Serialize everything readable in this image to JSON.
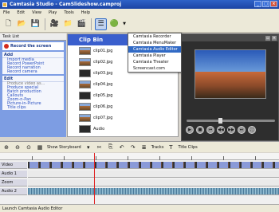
{
  "window": {
    "title": "Camtasia Studio - CamSlideshow.camproj",
    "controls": [
      "_",
      "□",
      "×"
    ]
  },
  "menu": [
    "File",
    "Edit",
    "View",
    "Play",
    "Tools",
    "Help"
  ],
  "task_panel": {
    "header": "Task List",
    "record_label": "Record the screen",
    "groups": [
      {
        "title": "Add",
        "items": [
          "Import media",
          "Record PowerPoint",
          "Record narration",
          "Record camera"
        ]
      },
      {
        "title": "Edit",
        "items": [
          "Produce video as...",
          "Produce special",
          "Batch production",
          "Callouts",
          "Zoom-n-Pan",
          "Picture-in-Picture",
          "Title clips"
        ]
      }
    ]
  },
  "clip_bin": {
    "title": "Clip Bin",
    "clips": [
      {
        "label": "clip01.jpg",
        "thumb": "land"
      },
      {
        "label": "clip02.jpg",
        "thumb": "land"
      },
      {
        "label": "clip03.jpg",
        "thumb": "dark"
      },
      {
        "label": "clip04.jpg",
        "thumb": "land"
      },
      {
        "label": "clip05.jpg",
        "thumb": "dark"
      },
      {
        "label": "clip06.jpg",
        "thumb": "land"
      },
      {
        "label": "clip07.jpg",
        "thumb": "land"
      },
      {
        "label": "Audio",
        "thumb": "dark"
      }
    ]
  },
  "tools_dropdown": {
    "items": [
      {
        "label": "Camtasia Recorder",
        "selected": false
      },
      {
        "label": "Camtasia MenuMaker",
        "selected": false
      },
      {
        "label": "Camtasia Audio Editor",
        "selected": true
      },
      {
        "label": "Camtasia Player",
        "selected": false
      },
      {
        "label": "Camtasia Theater",
        "selected": false
      },
      {
        "label": "Screencast.com",
        "selected": false
      }
    ]
  },
  "timeline_toolbar": {
    "show_storyboard": "Show Storyboard",
    "tracks": "Tracks",
    "title_clips": "Title Clips"
  },
  "tracks": [
    {
      "label": "Video",
      "kind": "video"
    },
    {
      "label": "Audio 1",
      "kind": "audio"
    },
    {
      "label": "Zoom",
      "kind": "audio"
    },
    {
      "label": "Audio 2",
      "kind": "audio2"
    }
  ],
  "statusbar": "Launch Camtasia Audio Editor",
  "colors": {
    "titlebar": "#2f62c8",
    "task_panel": "#7d9de3",
    "clip_bin_header": "#3a5fcd",
    "highlight": "#316ac5"
  }
}
